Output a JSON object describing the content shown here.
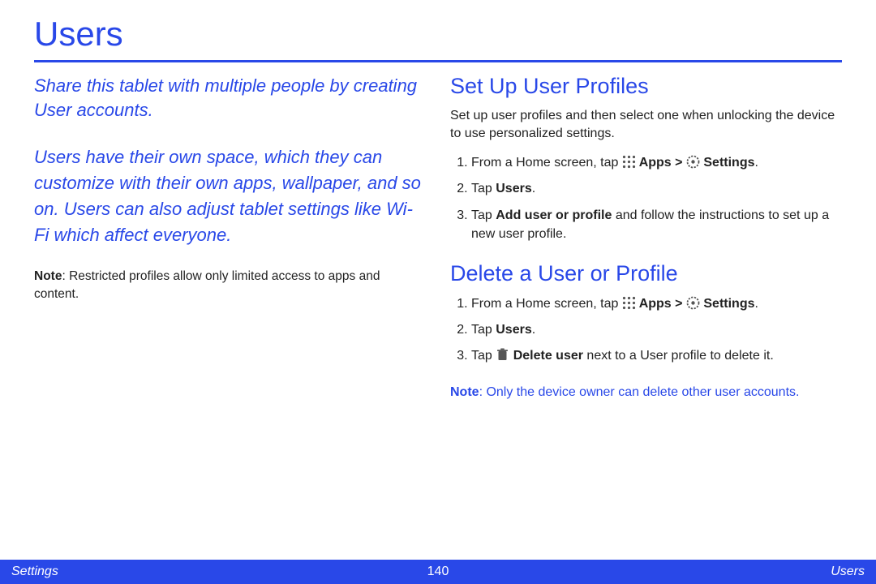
{
  "title": "Users",
  "left": {
    "intro1": "Share this tablet with multiple people by creating User accounts.",
    "intro2": "Users have their own space, which they can customize with their own apps, wallpaper, and so on. Users can also adjust tablet settings like Wi-Fi which affect everyone.",
    "note_label": "Note",
    "note_text": ": Restricted profiles allow only limited access to apps and content."
  },
  "right": {
    "setup": {
      "heading": "Set Up User Profiles",
      "desc": "Set up user profiles and then select one when unlocking the device to use personalized settings.",
      "steps": {
        "s1_a": "From a Home screen, tap ",
        "s1_b": " Apps > ",
        "s1_c": " Settings",
        "s1_d": ".",
        "s2_a": "Tap ",
        "s2_b": "Users",
        "s2_c": ".",
        "s3_a": "Tap ",
        "s3_b": "Add user or profile",
        "s3_c": " and follow the instructions to set up a new user profile."
      }
    },
    "delete": {
      "heading": "Delete a User or Profile",
      "steps": {
        "s1_a": "From a Home screen, tap ",
        "s1_b": " Apps > ",
        "s1_c": " Settings",
        "s1_d": ".",
        "s2_a": "Tap ",
        "s2_b": "Users",
        "s2_c": ".",
        "s3_a": "Tap ",
        "s3_b": " Delete user",
        "s3_c": " next to a User profile to delete it."
      },
      "note_label": "Note",
      "note_text": ": Only the device owner can delete other user accounts."
    }
  },
  "footer": {
    "left": "Settings",
    "center": "140",
    "right": "Users"
  }
}
